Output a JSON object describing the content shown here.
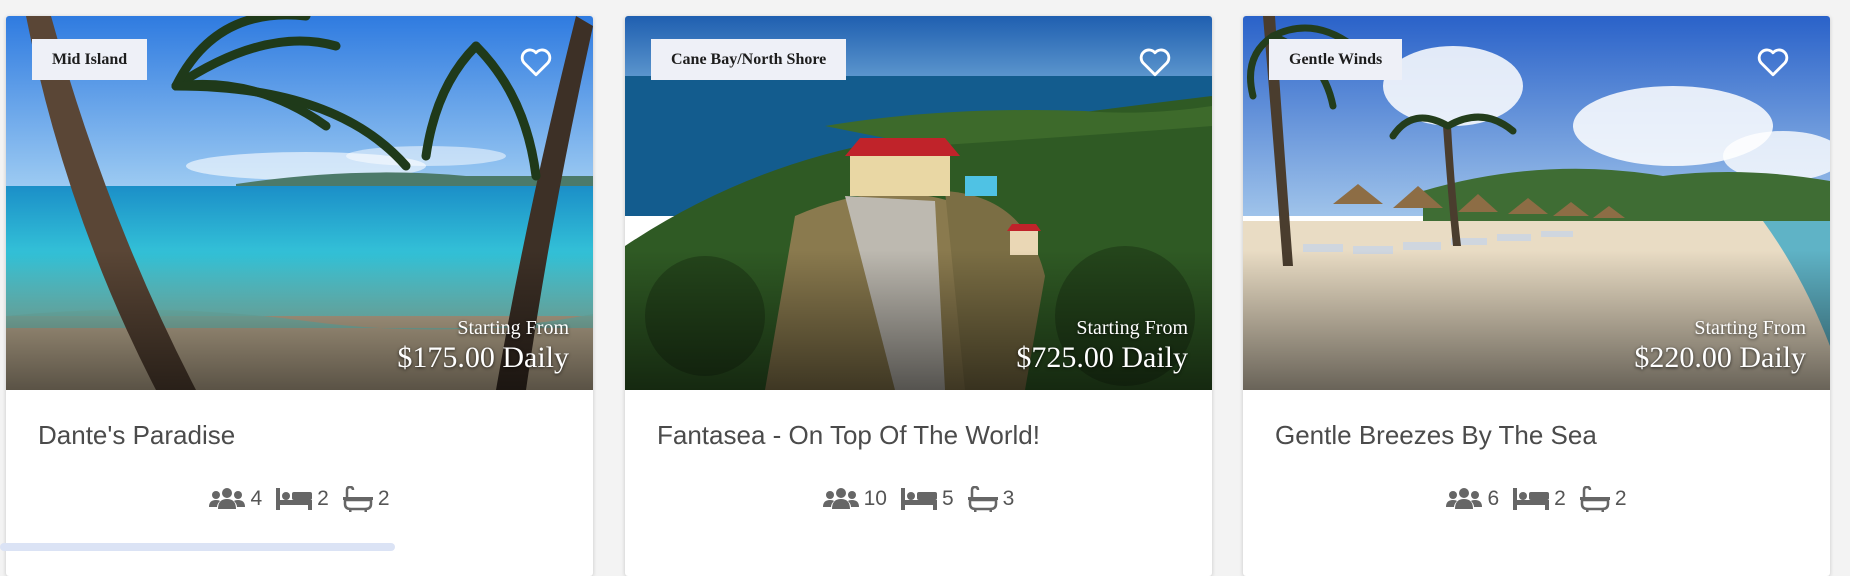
{
  "listings": [
    {
      "location": "Mid Island",
      "price_label": "Starting From",
      "price": "$175.00 Daily",
      "title": "Dante's Paradise",
      "guests": "4",
      "bedrooms": "2",
      "bathrooms": "2"
    },
    {
      "location": "Cane Bay/North Shore",
      "price_label": "Starting From",
      "price": "$725.00 Daily",
      "title": "Fantasea - On Top Of The World!",
      "guests": "10",
      "bedrooms": "5",
      "bathrooms": "3"
    },
    {
      "location": "Gentle Winds",
      "price_label": "Starting From",
      "price": "$220.00 Daily",
      "title": "Gentle Breezes By The Sea",
      "guests": "6",
      "bedrooms": "2",
      "bathrooms": "2"
    }
  ],
  "icons": {
    "favorite": "heart-outline-icon",
    "guests": "users-icon",
    "bedrooms": "bed-icon",
    "bathrooms": "bathtub-icon"
  },
  "colors": {
    "badge_bg": "#eef0f7",
    "title_text": "#4b4b4b",
    "feature_text": "#555555"
  }
}
